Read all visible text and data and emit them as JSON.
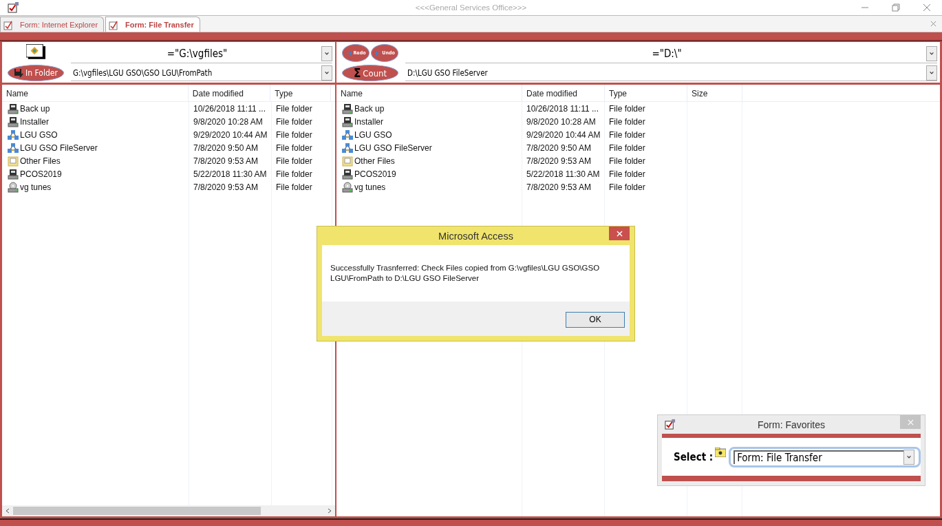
{
  "window": {
    "title": "<<<General Services Office>>>"
  },
  "tabs": [
    {
      "label": "Form: Internet Explorer",
      "selected": false
    },
    {
      "label": "Form: File Transfer",
      "selected": true
    }
  ],
  "left_pane": {
    "folder_button": "In Folder",
    "root_combo": "=\"G:\\vgfiles\"",
    "path_combo": "G:\\vgfiles\\LGU GSO\\GSO LGU\\FromPath",
    "columns": [
      "Name",
      "Date modified",
      "Type"
    ],
    "rows": [
      {
        "name": "Back up",
        "date": "10/26/2018 11:11 ...",
        "type": "File folder",
        "kind": "drive"
      },
      {
        "name": "Installer",
        "date": "9/8/2020 10:28 AM",
        "type": "File folder",
        "kind": "drive"
      },
      {
        "name": "LGU GSO",
        "date": "9/29/2020 10:44 AM",
        "type": "File folder",
        "kind": "network"
      },
      {
        "name": "LGU GSO FileServer",
        "date": "7/8/2020 9:50 AM",
        "type": "File folder",
        "kind": "network"
      },
      {
        "name": "Other Files",
        "date": "7/8/2020 9:53 AM",
        "type": "File folder",
        "kind": "folder"
      },
      {
        "name": "PCOS2019",
        "date": "5/22/2018 11:30 AM",
        "type": "File folder",
        "kind": "drive"
      },
      {
        "name": "vg tunes",
        "date": "7/8/2020 9:53 AM",
        "type": "File folder",
        "kind": "disc"
      }
    ]
  },
  "right_pane": {
    "redo_button": "Redo",
    "undo_button": "Undo",
    "count_symbol": "Σ",
    "count_button": "Count",
    "root_combo": "=\"D:\\\"",
    "path_combo": "D:\\LGU GSO FileServer",
    "columns": [
      "Name",
      "Date modified",
      "Type",
      "Size"
    ],
    "rows": [
      {
        "name": "Back up",
        "date": "10/26/2018 11:11 ...",
        "type": "File folder",
        "kind": "drive"
      },
      {
        "name": "Installer",
        "date": "9/8/2020 10:28 AM",
        "type": "File folder",
        "kind": "drive"
      },
      {
        "name": "LGU GSO",
        "date": "9/29/2020 10:44 AM",
        "type": "File folder",
        "kind": "network"
      },
      {
        "name": "LGU GSO FileServer",
        "date": "7/8/2020 9:50 AM",
        "type": "File folder",
        "kind": "network"
      },
      {
        "name": "Other Files",
        "date": "7/8/2020 9:53 AM",
        "type": "File folder",
        "kind": "folder"
      },
      {
        "name": "PCOS2019",
        "date": "5/22/2018 11:30 AM",
        "type": "File folder",
        "kind": "drive"
      },
      {
        "name": "vg tunes",
        "date": "7/8/2020 9:53 AM",
        "type": "File folder",
        "kind": "disc"
      }
    ]
  },
  "dialog": {
    "title": "Microsoft Access",
    "message": "Successfully Trasnferred: Check Files copied from G:\\vgfiles\\LGU GSO\\GSO LGU\\FromPath to D:\\LGU GSO FileServer",
    "button": "OK"
  },
  "favorites": {
    "title": "Form: Favorites",
    "label": "Select :",
    "value": "Form: File Transfer"
  }
}
